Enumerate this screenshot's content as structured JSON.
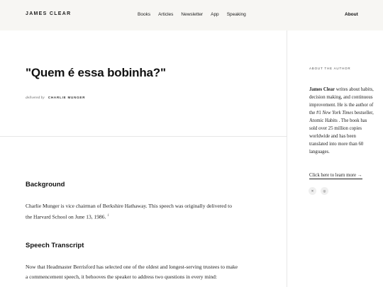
{
  "header": {
    "logo": "JAMES CLEAR",
    "nav": [
      "Books",
      "Articles",
      "Newsletter",
      "App",
      "Speaking"
    ],
    "about": "About"
  },
  "article": {
    "title": "\"Quem é essa bobinha?\"",
    "delivered_by_label": "delivered by",
    "author": "CHARLIE MUNGER"
  },
  "background": {
    "heading": "Background",
    "text": "Charlie Munger is vice chairman of Berkshire Hathaway. This speech was originally delivered to the Harvard School on June 13, 1986.",
    "footnote": "1"
  },
  "transcript": {
    "heading": "Speech Transcript",
    "text": "Now that Headmaster Berrisford has selected one of the oldest and longest-serving trustees to make a commencement speech, it behooves the speaker to address two questions in every mind:"
  },
  "sidebar": {
    "label": "ABOUT THE AUTHOR",
    "name": "James Clear",
    "bio_1": " writes about habits, decision making, and continuous improvement. He is the author of the #1 ",
    "bio_italic": "New York Times",
    "bio_2": " bestseller, Atomic Habits . The book has sold over 25 million copies worldwide and has been translated into more than 60 languages.",
    "cta": "Click here to learn more →",
    "social": [
      {
        "name": "twitter-icon",
        "glyph": "✕"
      },
      {
        "name": "instagram-icon",
        "glyph": "◎"
      }
    ]
  }
}
